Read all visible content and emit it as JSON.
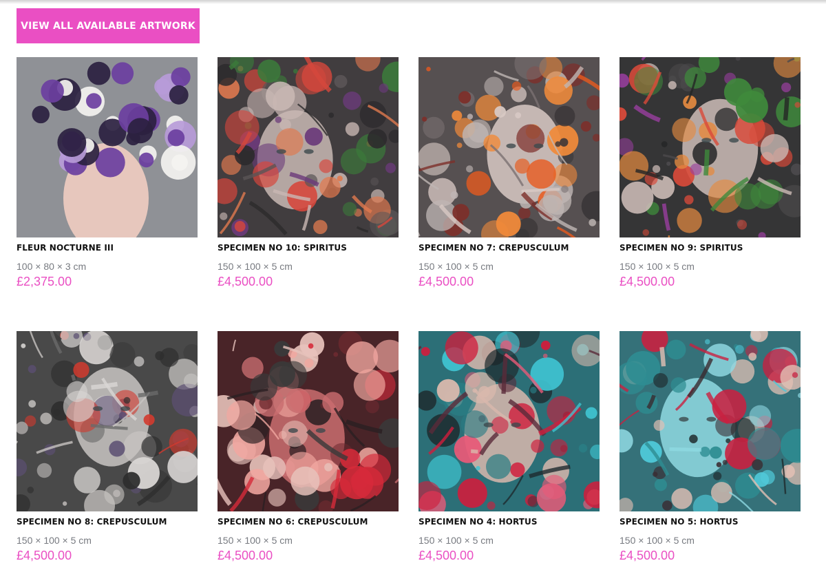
{
  "cta": {
    "label": "VIEW ALL AVAILABLE ARTWORK"
  },
  "products": [
    {
      "title": "FLEUR NOCTURNE III",
      "dimensions": "100 × 80 × 3 cm",
      "price": "£2,375.00",
      "palette": [
        "#8f9196",
        "#6b6e74",
        "#f4f3f0",
        "#6b3fa0",
        "#b79bd8",
        "#2b2140",
        "#e7c7bd"
      ]
    },
    {
      "title": "SPECIMEN NO 10: SPIRITUS",
      "dimensions": "150 × 100 × 5 cm",
      "price": "£4,500.00",
      "palette": [
        "#2c2a2c",
        "#5a5556",
        "#c9b8b4",
        "#d6473c",
        "#3b7a3a",
        "#6b3a7a",
        "#e0794f"
      ]
    },
    {
      "title": "SPECIMEN NO 7: CREPUSCULUM",
      "dimensions": "150 × 100 × 5 cm",
      "price": "£4,500.00",
      "palette": [
        "#3a3638",
        "#7a7072",
        "#d8c9c4",
        "#e85a1e",
        "#f08a3a",
        "#7d2f2a",
        "#bfb6b4"
      ]
    },
    {
      "title": "SPECIMEN NO 9: SPIRITUS",
      "dimensions": "150 × 100 × 5 cm",
      "price": "£4,500.00",
      "palette": [
        "#242526",
        "#4c4a4c",
        "#cdbcb7",
        "#9a3fa0",
        "#3f8a3c",
        "#d94a3a",
        "#e48a40"
      ]
    },
    {
      "title": "SPECIMEN NO 8: CREPUSCULUM",
      "dimensions": "150 × 100 × 5 cm",
      "price": "£4,500.00",
      "palette": [
        "#2e2e2e",
        "#6a6a6a",
        "#c8c4c2",
        "#d9d6d4",
        "#d23a2e",
        "#5c4f73",
        "#3c3c3c"
      ]
    },
    {
      "title": "SPECIMEN NO 6: CREPUSCULUM",
      "dimensions": "150 × 100 × 5 cm",
      "price": "£4,500.00",
      "palette": [
        "#2a1f22",
        "#6e2a30",
        "#c96d6f",
        "#e7c2bb",
        "#d62a3a",
        "#f1a7a0",
        "#3a3a3a"
      ]
    },
    {
      "title": "SPECIMEN NO 4: HORTUS",
      "dimensions": "150 × 100 × 5 cm",
      "price": "£4,500.00",
      "palette": [
        "#1e2a2e",
        "#3fc3d0",
        "#2a7d84",
        "#d01d3c",
        "#e85a78",
        "#d9b8ad",
        "#5a2a3a"
      ]
    },
    {
      "title": "SPECIMEN NO 5: HORTUS",
      "dimensions": "150 × 100 × 5 cm",
      "price": "£4,500.00",
      "palette": [
        "#1f2a2c",
        "#4fc8d8",
        "#2e8d92",
        "#c92040",
        "#e3c0b4",
        "#8fd9e2",
        "#3a2a30"
      ]
    }
  ]
}
